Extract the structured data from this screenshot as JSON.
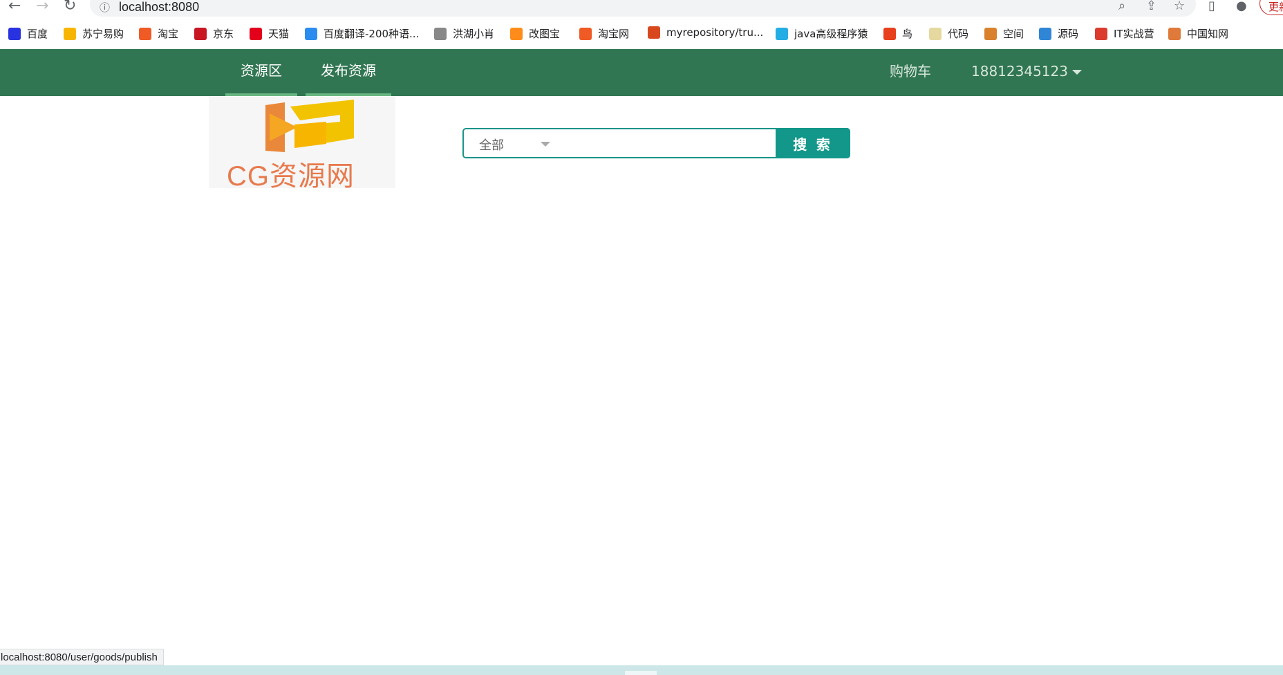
{
  "browser": {
    "url": "localhost:8080",
    "update_label": "更新"
  },
  "bookmarks": [
    {
      "label": "百度",
      "icon": "baidu-icon",
      "color": "#2932e1"
    },
    {
      "label": "苏宁易购",
      "icon": "suning-icon",
      "color": "#f7b500"
    },
    {
      "label": "淘宝",
      "icon": "taobao-icon",
      "color": "#f05a24"
    },
    {
      "label": "京东",
      "icon": "jd-icon",
      "color": "#c81623"
    },
    {
      "label": "天猫",
      "icon": "tmall-icon",
      "color": "#e4001b"
    },
    {
      "label": "百度翻译-200种语...",
      "icon": "translate-icon",
      "color": "#2b8cf0"
    },
    {
      "label": "洪湖小肖",
      "icon": "bird-icon",
      "color": "#888888"
    },
    {
      "label": "改图宝",
      "icon": "gaitubao-icon",
      "color": "#ff8c1a"
    },
    {
      "label": "淘宝网",
      "icon": "taobao-icon",
      "color": "#f05a24"
    },
    {
      "label": "myrepository/tru...",
      "icon": "repo-icon",
      "color": "#d9471f"
    },
    {
      "label": "java高级程序猿",
      "icon": "bilibili-icon",
      "color": "#23ade5"
    },
    {
      "label": "鸟",
      "icon": "bird-icon",
      "color": "#e8401c"
    },
    {
      "label": "代码",
      "icon": "code-icon",
      "color": "#e6d9a0"
    },
    {
      "label": "空间",
      "icon": "qzone-icon",
      "color": "#d9822b"
    },
    {
      "label": "源码",
      "icon": "source-icon",
      "color": "#2f86d6"
    },
    {
      "label": "IT实战营",
      "icon": "chrome-icon",
      "color": "#db3b2d"
    },
    {
      "label": "中国知网",
      "icon": "cnki-icon",
      "color": "#e07a3a"
    }
  ],
  "nav": {
    "tabs": [
      {
        "label": "资源区"
      },
      {
        "label": "发布资源"
      }
    ],
    "cart_label": "购物车",
    "user_label": "18812345123"
  },
  "logo": {
    "text": "CG资源网"
  },
  "search": {
    "category": "全部",
    "value": "",
    "button_label": "搜 索"
  },
  "status_bar": {
    "text": "localhost:8080/user/goods/publish"
  },
  "colors": {
    "nav_bg": "#317652",
    "tab_underline": "#6ab683",
    "search_accent": "#12978a"
  }
}
